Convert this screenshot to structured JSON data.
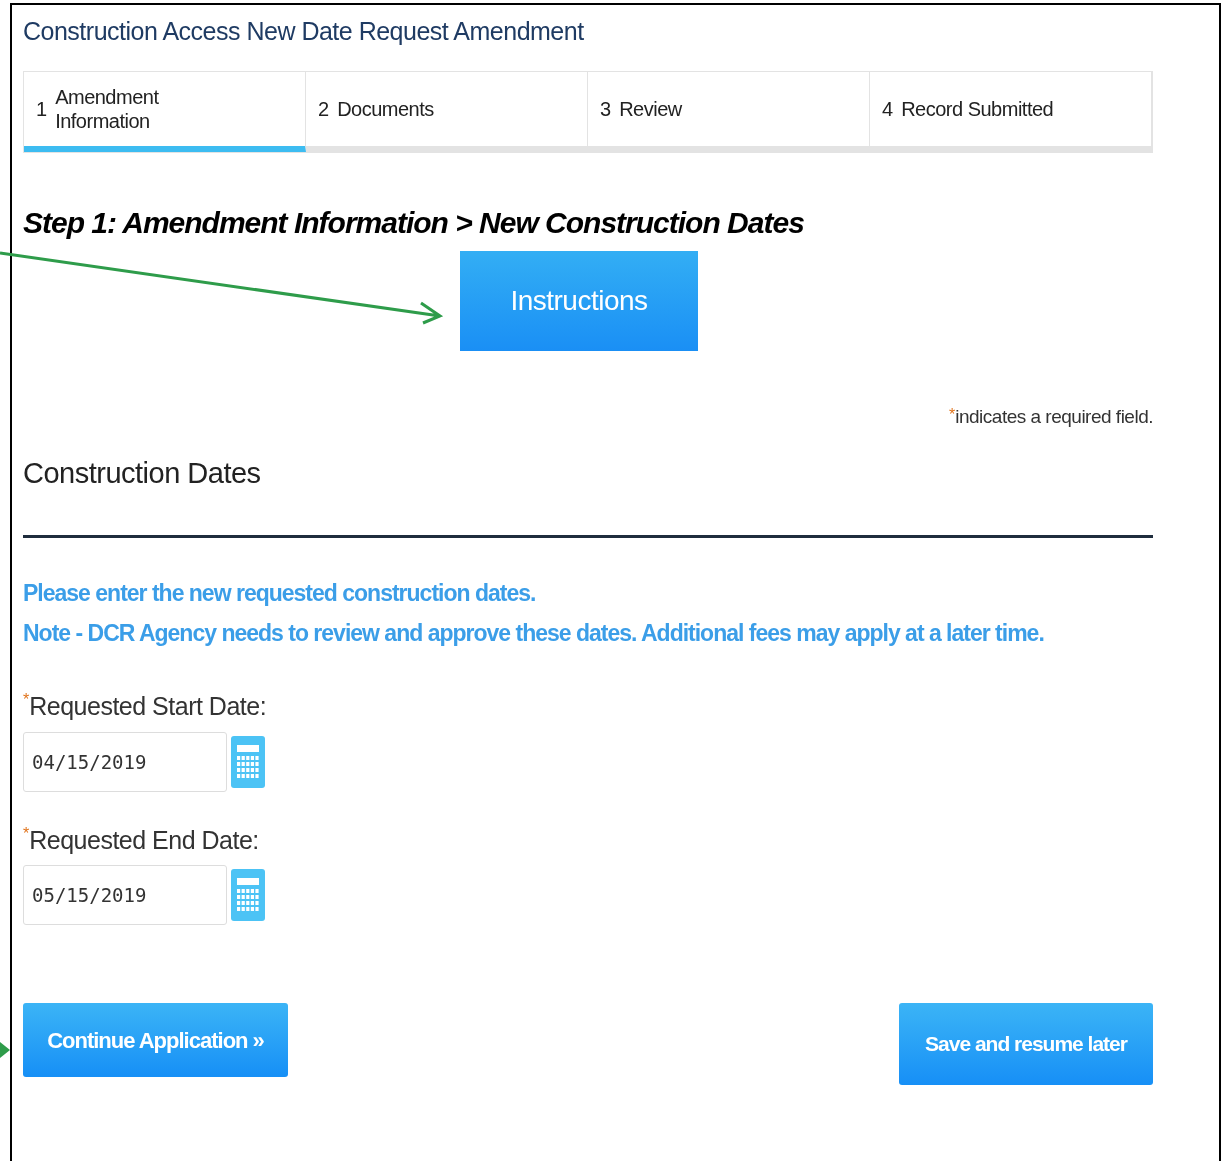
{
  "page_title": "Construction Access New Date Request Amendment",
  "steps": [
    {
      "number": "1",
      "label": "Amendment Information",
      "selected": true
    },
    {
      "number": "2",
      "label": "Documents",
      "selected": false
    },
    {
      "number": "3",
      "label": "Review",
      "selected": false
    },
    {
      "number": "4",
      "label": "Record Submitted",
      "selected": false
    }
  ],
  "step_heading": "Step 1: Amendment Information > New Construction Dates",
  "instructions_button": "Instructions",
  "required_note": {
    "mark": "*",
    "text": "indicates a required field."
  },
  "section_title": "Construction Dates",
  "notes": [
    "Please enter the new requested construction dates.",
    "Note - DCR Agency needs to review and approve these dates. Additional fees may apply at a later time."
  ],
  "fields": [
    {
      "label": "Requested Start Date:",
      "required": true,
      "value": "04/15/2019"
    },
    {
      "label": "Requested End Date:",
      "required": true,
      "value": "05/15/2019"
    }
  ],
  "buttons": {
    "continue": "Continue Application »",
    "save": "Save and resume later"
  }
}
